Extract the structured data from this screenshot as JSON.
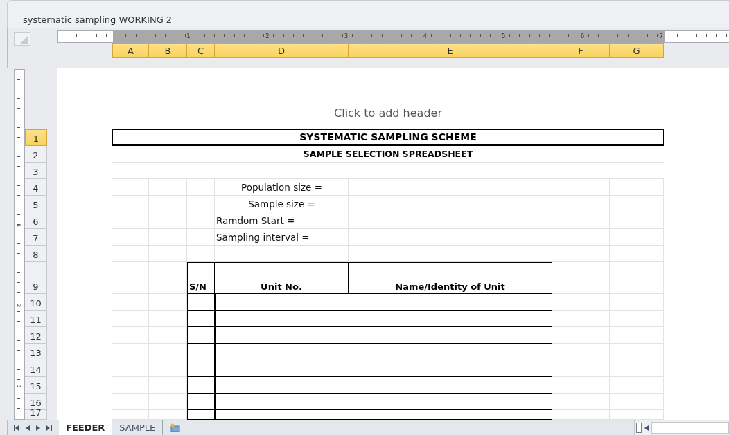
{
  "window": {
    "title": "systematic sampling WORKING 2"
  },
  "ruler_labels": [
    "1",
    "2",
    "3",
    "4",
    "5",
    "6",
    "7"
  ],
  "vertical_ruler_labels": [
    "1",
    "2",
    "3"
  ],
  "columns": [
    {
      "label": "A",
      "selected": true
    },
    {
      "label": "B",
      "selected": true
    },
    {
      "label": "C",
      "selected": true
    },
    {
      "label": "D",
      "selected": true
    },
    {
      "label": "E",
      "selected": true
    },
    {
      "label": "F",
      "selected": true
    },
    {
      "label": "G",
      "selected": true
    }
  ],
  "header_placeholder": "Click to add header",
  "rows": [
    {
      "label": "1",
      "selected": true
    },
    {
      "label": "2",
      "selected": false
    },
    {
      "label": "3",
      "selected": false
    },
    {
      "label": "4",
      "selected": false
    },
    {
      "label": "5",
      "selected": false
    },
    {
      "label": "6",
      "selected": false
    },
    {
      "label": "7",
      "selected": false
    },
    {
      "label": "8",
      "selected": false
    },
    {
      "label": "9",
      "selected": false
    },
    {
      "label": "10",
      "selected": false
    },
    {
      "label": "11",
      "selected": false
    },
    {
      "label": "12",
      "selected": false
    },
    {
      "label": "13",
      "selected": false
    },
    {
      "label": "14",
      "selected": false
    },
    {
      "label": "15",
      "selected": false
    },
    {
      "label": "16",
      "selected": false
    },
    {
      "label": "17",
      "selected": false
    }
  ],
  "sheet": {
    "title": "SYSTEMATIC SAMPLING SCHEME",
    "subtitle": "SAMPLE SELECTION SPREADSHEET",
    "parameters": [
      {
        "label": "Population size =",
        "kind": "centered"
      },
      {
        "label": "Sample  size =",
        "kind": "centered"
      },
      {
        "label": "Ramdom Start =",
        "kind": "left"
      },
      {
        "label": "Sampling interval =",
        "kind": "left"
      }
    ],
    "table_headers": [
      "S/N",
      "Unit No.",
      "Name/Identity of Unit"
    ]
  },
  "sheet_tabs": [
    {
      "label": "FEEDER",
      "selected": true
    },
    {
      "label": "SAMPLE",
      "selected": false
    }
  ]
}
